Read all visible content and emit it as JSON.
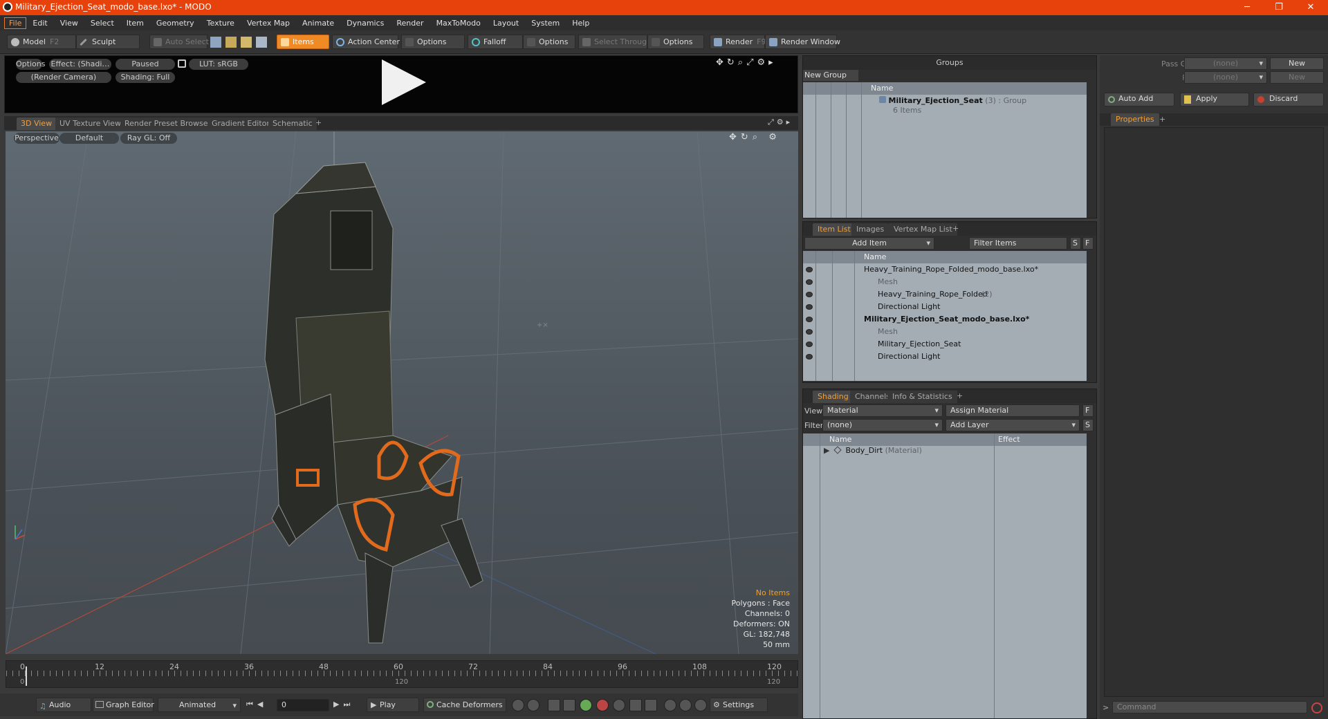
{
  "window": {
    "title": "Military_Ejection_Seat_modo_base.lxo* - MODO",
    "minimize": "─",
    "restore": "❐",
    "close": "✕"
  },
  "menu": [
    "File",
    "Edit",
    "View",
    "Select",
    "Item",
    "Geometry",
    "Texture",
    "Vertex Map",
    "Animate",
    "Dynamics",
    "Render",
    "MaxToModo",
    "Layout",
    "System",
    "Help"
  ],
  "toolbar": {
    "model": "Model",
    "model_key": "F2",
    "sculpt": "Sculpt",
    "auto_select": "Auto Select",
    "items": "Items",
    "action_center": "Action Center",
    "options1": "Options",
    "falloff": "Falloff",
    "options2": "Options",
    "select_through": "Select Through",
    "options3": "Options",
    "render": "Render",
    "render_key": "F9",
    "render_window": "Render Window"
  },
  "preview": {
    "options": "Options",
    "effect": "Effect: (Shadi…",
    "paused": "Paused",
    "lut": "LUT: sRGB",
    "camera": "(Render Camera)",
    "shading": "Shading: Full"
  },
  "viewtabs": [
    "3D View",
    "UV Texture View",
    "Render Preset Browser",
    "Gradient Editor",
    "Schematic",
    "+"
  ],
  "viewport": {
    "perspective": "Perspective",
    "default": "Default",
    "raygl": "Ray GL: Off",
    "stats": {
      "no_items": "No Items",
      "polygons": "Polygons : Face",
      "channels": "Channels: 0",
      "deformers": "Deformers: ON",
      "gl": "GL: 182,748",
      "scale": "50 mm"
    }
  },
  "timeline": {
    "top_ticks": [
      "0",
      "12",
      "24",
      "36",
      "48",
      "60",
      "72",
      "84",
      "96",
      "108",
      "120"
    ],
    "start": "0",
    "mid": "120",
    "end": "120"
  },
  "bottombar": {
    "audio": "Audio",
    "graph_editor": "Graph Editor",
    "animated": "Animated",
    "frame": "0",
    "play": "Play",
    "cache_deformers": "Cache Deformers",
    "settings": "Settings"
  },
  "groups": {
    "title": "Groups",
    "new_group": "New Group",
    "col_name": "Name",
    "item_name": "Military_Ejection_Seat",
    "item_count": "(3)",
    "item_type": ": Group",
    "item_sub": "6 Items"
  },
  "itemlist": {
    "tabs": [
      "Item List",
      "Images",
      "Vertex Map List",
      "+"
    ],
    "add_item": "Add Item",
    "filter_items": "Filter Items",
    "s": "S",
    "f": "F",
    "col_name": "Name",
    "rows": [
      {
        "label": "Heavy_Training_Rope_Folded_modo_base.lxo*",
        "suffix": "",
        "bold": false,
        "gray": false
      },
      {
        "label": "Mesh",
        "suffix": "",
        "bold": false,
        "gray": true
      },
      {
        "label": "Heavy_Training_Rope_Folded",
        "suffix": "(2)",
        "bold": false,
        "gray": false
      },
      {
        "label": "Directional Light",
        "suffix": "",
        "bold": false,
        "gray": false
      },
      {
        "label": "Military_Ejection_Seat_modo_base.lxo*",
        "suffix": "",
        "bold": true,
        "gray": false
      },
      {
        "label": "Mesh",
        "suffix": "",
        "bold": false,
        "gray": true
      },
      {
        "label": "Military_Ejection_Seat",
        "suffix": "",
        "bold": false,
        "gray": false
      },
      {
        "label": "Directional Light",
        "suffix": "",
        "bold": false,
        "gray": false
      }
    ]
  },
  "shading": {
    "tabs": [
      "Shading",
      "Channels",
      "Info & Statistics",
      "+"
    ],
    "view_label": "View",
    "view_value": "Material",
    "assign_material": "Assign Material",
    "f": "F",
    "filter_label": "Filter",
    "filter_value": "(none)",
    "add_layer": "Add Layer",
    "s": "S",
    "col_name": "Name",
    "col_effect": "Effect",
    "row_name": "Body_Dirt",
    "row_type": "(Material)"
  },
  "passes": {
    "pass_groups": "Pass Groups",
    "pass_value": "(none)",
    "new1": "New",
    "passes": "Passes",
    "passes_value": "(none)",
    "new2": "New"
  },
  "actions": {
    "auto_add": "Auto Add",
    "apply": "Apply",
    "discard": "Discard"
  },
  "properties": {
    "tab": "Properties",
    "plus": "+"
  },
  "command": {
    "placeholder": "Command"
  },
  "colors": {
    "accent": "#e8420c",
    "active": "#f08a24",
    "orange_part": "#e26a1c"
  }
}
